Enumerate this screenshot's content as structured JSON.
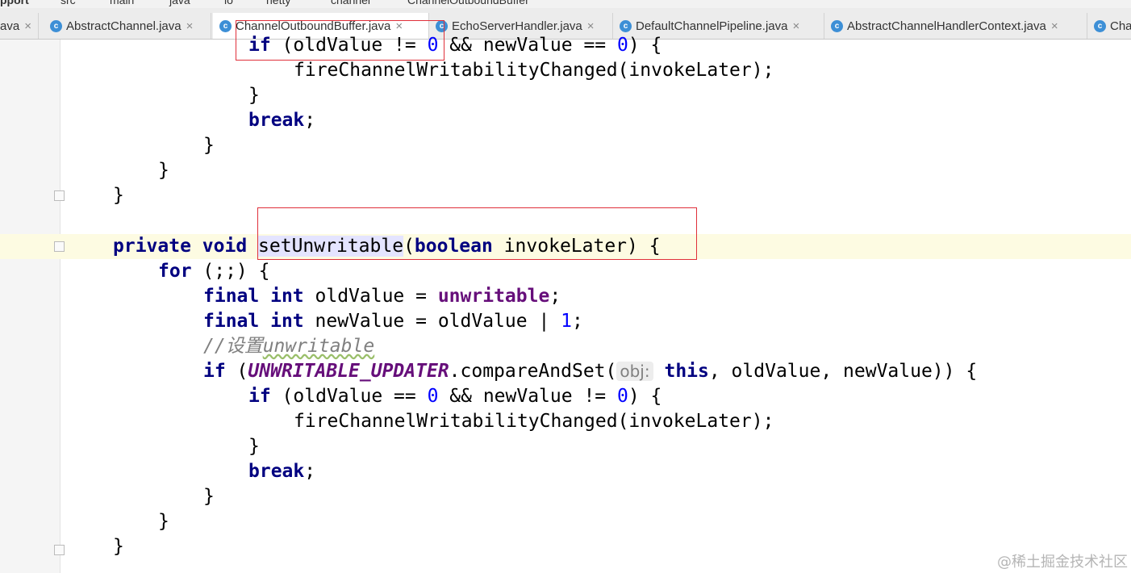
{
  "breadcrumb": [
    "pport",
    "src",
    "main",
    "java",
    "io",
    "netty",
    "channel",
    "ChannelOutboundBuffer"
  ],
  "tabs": [
    {
      "label": "ava",
      "active": false
    },
    {
      "label": "AbstractChannel.java",
      "active": false
    },
    {
      "label": "ChannelOutboundBuffer.java",
      "active": true
    },
    {
      "label": "EchoServerHandler.java",
      "active": false
    },
    {
      "label": "DefaultChannelPipeline.java",
      "active": false
    },
    {
      "label": "AbstractChannelHandlerContext.java",
      "active": false
    },
    {
      "label": "Cha",
      "active": false
    }
  ],
  "code": {
    "l1_if": "if",
    "l1_rest_a": " (oldValue != ",
    "l1_zero_a": "0",
    "l1_rest_b": " && newValue == ",
    "l1_zero_b": "0",
    "l1_rest_c": ") {",
    "l2": "fireChannelWritabilityChanged(invokeLater);",
    "l3": "}",
    "l4_kw": "break",
    "l4_semi": ";",
    "l5": "}",
    "l6": "}",
    "l7": "}",
    "l8_private": "private",
    "l8_void": "void",
    "l8_method": "setUnwritable",
    "l8_paren": "(",
    "l8_boolean": "boolean",
    "l8_rest": " invokeLater) {",
    "l9_for": "for",
    "l9_rest": " (;;) {",
    "l10_final": "final",
    "l10_int": "int",
    "l10_rest": " oldValue = ",
    "l10_field": "unwritable",
    "l10_semi": ";",
    "l11_final": "final",
    "l11_int": "int",
    "l11_rest": " newValue = oldValue | ",
    "l11_num": "1",
    "l11_semi": ";",
    "l12_comment_a": "//设置",
    "l12_comment_b": "unwritable",
    "l13_if": "if",
    "l13_open": " (",
    "l13_field": "UNWRITABLE_UPDATER",
    "l13_call": ".compareAndSet(",
    "l13_hint": "obj:",
    "l13_this": "this",
    "l13_rest": ", oldValue, newValue)) {",
    "l14_if": "if",
    "l14_rest_a": " (oldValue == ",
    "l14_zero_a": "0",
    "l14_rest_b": " && newValue != ",
    "l14_zero_b": "0",
    "l14_rest_c": ") {",
    "l15": "fireChannelWritabilityChanged(invokeLater);",
    "l16": "}",
    "l17_kw": "break",
    "l17_semi": ";",
    "l18": "}",
    "l19": "}",
    "l20": "}"
  },
  "watermark": "@稀土掘金技术社区",
  "colors": {
    "keyword": "#000080",
    "field": "#660e7a",
    "number": "#0000ff",
    "comment": "#808080",
    "annotation_box": "#e0303a"
  }
}
